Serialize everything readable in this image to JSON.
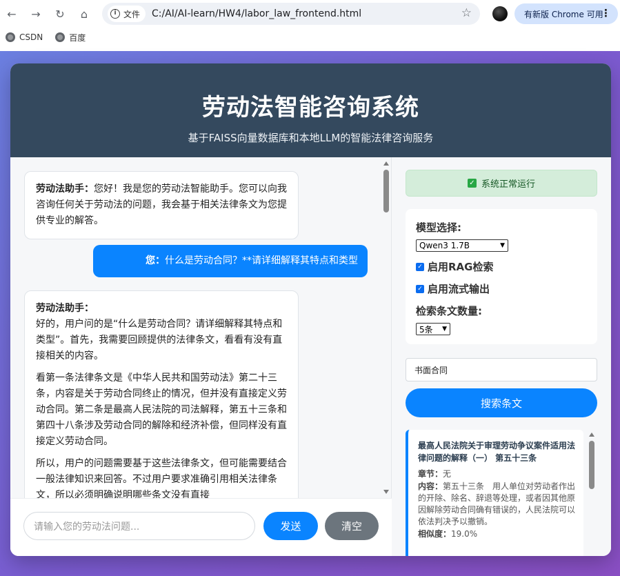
{
  "browser": {
    "info_label": "文件",
    "url": "C:/AI/AI-learn/HW4/labor_law_frontend.html",
    "update_label": "有新版 Chrome 可用",
    "bookmarks": [
      {
        "label": "CSDN"
      },
      {
        "label": "百度"
      }
    ]
  },
  "header": {
    "title": "劳动法智能咨询系统",
    "subtitle": "基于FAISS向量数据库和本地LLM的智能法律咨询服务"
  },
  "chat": {
    "bot_name": "劳动法助手：",
    "user_name": "您：",
    "welcome": "您好！我是您的劳动法智能助手。您可以向我咨询任何关于劳动法的问题，我会基于相关法律条文为您提供专业的解答。",
    "user_question": "什么是劳动合同？**请详细解释其特点和类型",
    "answer_p1": "好的，用户问的是“什么是劳动合同？请详细解释其特点和类型”。首先，我需要回顾提供的法律条文，看看有没有直接相关的内容。",
    "answer_p2": "看第一条法律条文是《中华人民共和国劳动法》第二十三条，内容是关于劳动合同终止的情况，但并没有直接定义劳动合同。第二条是最高人民法院的司法解释，第五十三条和第四十八条涉及劳动合同的解除和经济补偿，但同样没有直接定义劳动合同。",
    "answer_p3": "所以，用户的问题需要基于这些法律条文，但可能需要结合一般法律知识来回答。不过用户要求准确引用相关法律条文，所以必须明确说明哪些条文没有直接",
    "input_placeholder": "请输入您的劳动法问题...",
    "send_label": "发送",
    "clear_label": "清空"
  },
  "sidebar": {
    "status": "系统正常运行",
    "model_label": "模型选择:",
    "model_value": "Qwen3 1.7B",
    "rag_label": "启用RAG检索",
    "stream_label": "启用流式输出",
    "count_label": "检索条文数量:",
    "count_value": "5条",
    "search_value": "书面合同",
    "search_button": "搜索条文",
    "result": {
      "title": "最高人民法院关于审理劳动争议案件适用法律问题的解释（一） 第五十三条",
      "chapter_label": "章节：",
      "chapter_value": "无",
      "content_label": "内容：",
      "content_value": "第五十三条　用人单位对劳动者作出的开除、除名、辞退等处理，或者因其他原因解除劳动合同确有错误的，人民法院可以依法判决予以撤销。",
      "similarity_label": "相似度：",
      "similarity_value": "19.0%"
    }
  }
}
